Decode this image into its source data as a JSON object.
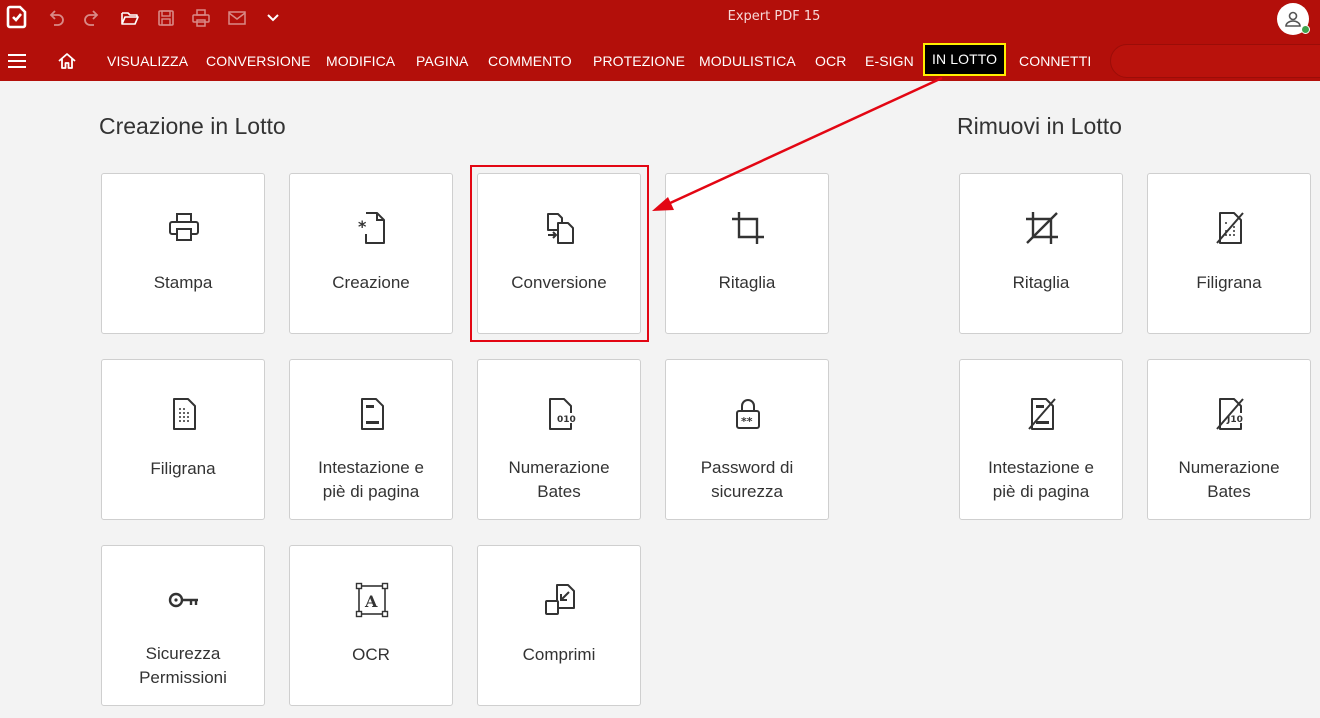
{
  "window": {
    "title": "Expert PDF 15"
  },
  "quick_access": {
    "icons": [
      "app-logo-icon",
      "undo-icon",
      "redo-icon",
      "open-folder-icon",
      "save-icon",
      "print-icon",
      "email-icon",
      "chevron-down-icon"
    ]
  },
  "nav": {
    "tabs": [
      {
        "label": "VISUALIZZA"
      },
      {
        "label": "CONVERSIONE"
      },
      {
        "label": "MODIFICA"
      },
      {
        "label": "PAGINA"
      },
      {
        "label": "COMMENTO"
      },
      {
        "label": "PROTEZIONE"
      },
      {
        "label": "MODULISTICA"
      },
      {
        "label": "OCR"
      },
      {
        "label": "E-SIGN"
      },
      {
        "label": "IN LOTTO",
        "active": true
      },
      {
        "label": "CONNETTI"
      }
    ]
  },
  "sections": {
    "creazione": {
      "title": "Creazione in Lotto",
      "tiles": [
        {
          "label": "Stampa",
          "icon": "printer-icon"
        },
        {
          "label": "Creazione",
          "icon": "new-document-icon"
        },
        {
          "label": "Conversione",
          "icon": "convert-document-icon",
          "highlighted": true
        },
        {
          "label": "Ritaglia",
          "icon": "crop-icon"
        },
        {
          "label": "Filigrana",
          "icon": "watermark-icon"
        },
        {
          "label": "Intestazione e\npiè di pagina",
          "icon": "header-footer-icon"
        },
        {
          "label": "Numerazione\nBates",
          "icon": "bates-numbering-icon"
        },
        {
          "label": "Password di\nsicurezza",
          "icon": "password-lock-icon"
        },
        {
          "label": "Sicurezza\nPermissioni",
          "icon": "key-icon"
        },
        {
          "label": "OCR",
          "icon": "ocr-icon"
        },
        {
          "label": "Comprimi",
          "icon": "compress-icon"
        }
      ]
    },
    "rimuovi": {
      "title": "Rimuovi in Lotto",
      "tiles": [
        {
          "label": "Ritaglia",
          "icon": "remove-crop-icon"
        },
        {
          "label": "Filigrana",
          "icon": "remove-watermark-icon"
        },
        {
          "label": "Intestazione e\npiè di pagina",
          "icon": "remove-header-footer-icon"
        },
        {
          "label": "Numerazione\nBates",
          "icon": "remove-bates-icon"
        }
      ]
    }
  },
  "colors": {
    "brand_red": "#b30f0a",
    "active_tab_bg": "#000000",
    "active_tab_border": "#ffee00",
    "annotation_red": "#e30613"
  }
}
